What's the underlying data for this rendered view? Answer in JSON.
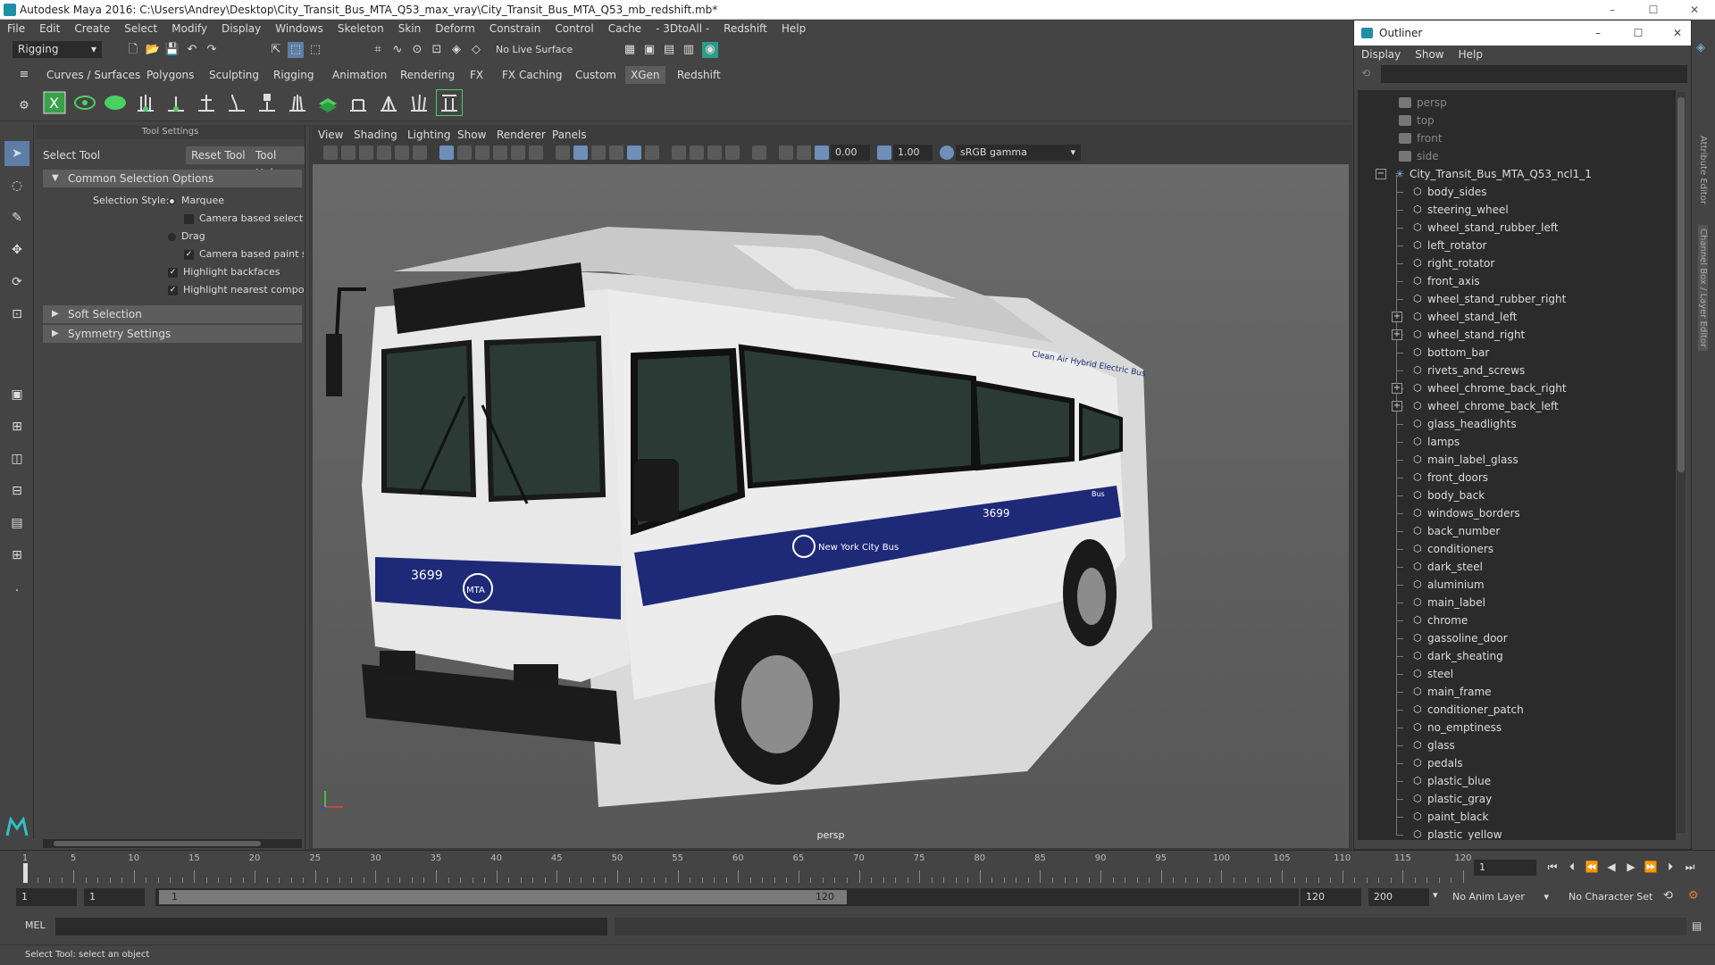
{
  "window": {
    "title": "Autodesk Maya 2016: C:\\Users\\Andrey\\Desktop\\City_Transit_Bus_MTA_Q53_max_vray\\City_Transit_Bus_MTA_Q53_mb_redshift.mb*",
    "minimize": "–",
    "maximize": "☐",
    "close": "✕"
  },
  "menubar": [
    "File",
    "Edit",
    "Create",
    "Select",
    "Modify",
    "Display",
    "Windows",
    "Skeleton",
    "Skin",
    "Deform",
    "Constrain",
    "Control",
    "Cache",
    "- 3DtoAll -",
    "Redshift",
    "Help"
  ],
  "status_line": {
    "mode": "Rigging",
    "live_surface": "No Live Surface"
  },
  "shelf_tabs": {
    "items": [
      "Curves / Surfaces",
      "Polygons",
      "Sculpting",
      "Rigging",
      "Animation",
      "Rendering",
      "FX",
      "FX Caching",
      "Custom",
      "XGen",
      "Redshift"
    ],
    "active": "XGen"
  },
  "tool_settings": {
    "panel_title": "Tool Settings",
    "tool_name": "Select Tool",
    "reset_button": "Reset Tool",
    "help_button": "Tool Help",
    "sections": {
      "common": "Common Selection Options",
      "soft": "Soft Selection",
      "symmetry": "Symmetry Settings"
    },
    "selection_style_label": "Selection Style:",
    "options": {
      "marquee": "Marquee",
      "camera_sel": "Camera based selectio",
      "drag": "Drag",
      "camera_paint": "Camera based paint se",
      "backfaces": "Highlight backfaces",
      "nearest": "Highlight nearest compor"
    }
  },
  "viewport": {
    "menus": [
      "View",
      "Shading",
      "Lighting",
      "Show",
      "Renderer",
      "Panels"
    ],
    "exposure": "0.00",
    "gamma": "1.00",
    "color_space": "sRGB gamma",
    "camera_label": "persp",
    "bus_texts": {
      "number_front": "3699",
      "number_side": "3699",
      "brand": "MTA",
      "side_text": "New York City Bus",
      "roof_text": "Clean Air Hybrid Electric Bus",
      "rear_text": "Bus"
    }
  },
  "outliner": {
    "title": "Outliner",
    "menus": [
      "Display",
      "Show",
      "Help"
    ],
    "cameras": [
      "persp",
      "top",
      "front",
      "side"
    ],
    "root": "City_Transit_Bus_MTA_Q53_ncl1_1",
    "items": [
      {
        "name": "body_sides",
        "expandable": false
      },
      {
        "name": "steering_wheel",
        "expandable": false
      },
      {
        "name": "wheel_stand_rubber_left",
        "expandable": false
      },
      {
        "name": "left_rotator",
        "expandable": false
      },
      {
        "name": "right_rotator",
        "expandable": false
      },
      {
        "name": "front_axis",
        "expandable": false
      },
      {
        "name": "wheel_stand_rubber_right",
        "expandable": false
      },
      {
        "name": "wheel_stand_left",
        "expandable": true
      },
      {
        "name": "wheel_stand_right",
        "expandable": true
      },
      {
        "name": "bottom_bar",
        "expandable": false
      },
      {
        "name": "rivets_and_screws",
        "expandable": false
      },
      {
        "name": "wheel_chrome_back_right",
        "expandable": true
      },
      {
        "name": "wheel_chrome_back_left",
        "expandable": true
      },
      {
        "name": "glass_headlights",
        "expandable": false
      },
      {
        "name": "lamps",
        "expandable": false
      },
      {
        "name": "main_label_glass",
        "expandable": false
      },
      {
        "name": "front_doors",
        "expandable": false
      },
      {
        "name": "body_back",
        "expandable": false
      },
      {
        "name": "windows_borders",
        "expandable": false
      },
      {
        "name": "back_number",
        "expandable": false
      },
      {
        "name": "conditioners",
        "expandable": false
      },
      {
        "name": "dark_steel",
        "expandable": false
      },
      {
        "name": "aluminium",
        "expandable": false
      },
      {
        "name": "main_label",
        "expandable": false
      },
      {
        "name": "chrome",
        "expandable": false
      },
      {
        "name": "gassoline_door",
        "expandable": false
      },
      {
        "name": "dark_sheating",
        "expandable": false
      },
      {
        "name": "steel",
        "expandable": false
      },
      {
        "name": "main_frame",
        "expandable": false
      },
      {
        "name": "conditioner_patch",
        "expandable": false
      },
      {
        "name": "no_emptiness",
        "expandable": false
      },
      {
        "name": "glass",
        "expandable": false
      },
      {
        "name": "pedals",
        "expandable": false
      },
      {
        "name": "plastic_blue",
        "expandable": false
      },
      {
        "name": "plastic_gray",
        "expandable": false
      },
      {
        "name": "paint_black",
        "expandable": false
      },
      {
        "name": "plastic_yellow",
        "expandable": false
      }
    ]
  },
  "side_panels": [
    "Attribute Editor",
    "Channel Box / Layer Editor"
  ],
  "timeline": {
    "ticks": [
      1,
      5,
      10,
      15,
      20,
      25,
      30,
      35,
      40,
      45,
      50,
      55,
      60,
      65,
      70,
      75,
      80,
      85,
      90,
      95,
      100,
      105,
      110,
      115,
      120
    ],
    "current_frame": "1"
  },
  "range": {
    "start": "1",
    "playback_start": "1",
    "slider_start": "1",
    "slider_end": "120",
    "playback_end": "120",
    "end": "200",
    "anim_layer": "No Anim Layer",
    "character_set": "No Character Set"
  },
  "command_line": {
    "label": "MEL"
  },
  "status": {
    "help_line": "Select Tool: select an object"
  },
  "colors": {
    "accent": "#5e7ea6",
    "bus_stripe": "#1e2a78",
    "bus_body": "#e8e8e8",
    "glass": "#2b3a35"
  }
}
